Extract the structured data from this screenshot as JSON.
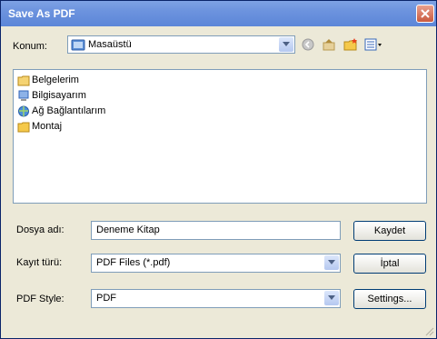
{
  "window": {
    "title": "Save As PDF"
  },
  "location": {
    "label": "Konum:",
    "value": "Masaüstü",
    "icon": "desktop-folder-icon"
  },
  "toolbar": {
    "back_icon": "back-icon",
    "up_icon": "up-folder-icon",
    "new_folder_icon": "new-folder-icon",
    "view_icon": "view-menu-icon"
  },
  "files": [
    {
      "name": "Belgelerim",
      "icon": "my-documents-icon"
    },
    {
      "name": "Bilgisayarım",
      "icon": "my-computer-icon"
    },
    {
      "name": "Ağ Bağlantılarım",
      "icon": "network-places-icon"
    },
    {
      "name": "Montaj",
      "icon": "folder-icon"
    }
  ],
  "form": {
    "filename_label": "Dosya adı:",
    "filename_value": "Deneme Kitap",
    "filetype_label": "Kayıt türü:",
    "filetype_value": "PDF Files (*.pdf)",
    "style_label": "PDF Style:",
    "style_value": "PDF"
  },
  "buttons": {
    "save": "Kaydet",
    "cancel": "İptal",
    "settings": "Settings..."
  },
  "colors": {
    "titlebar": "#6C93DE",
    "dialog_bg": "#ECE9D8",
    "border": "#7F9DB9",
    "close": "#C95A3F"
  }
}
